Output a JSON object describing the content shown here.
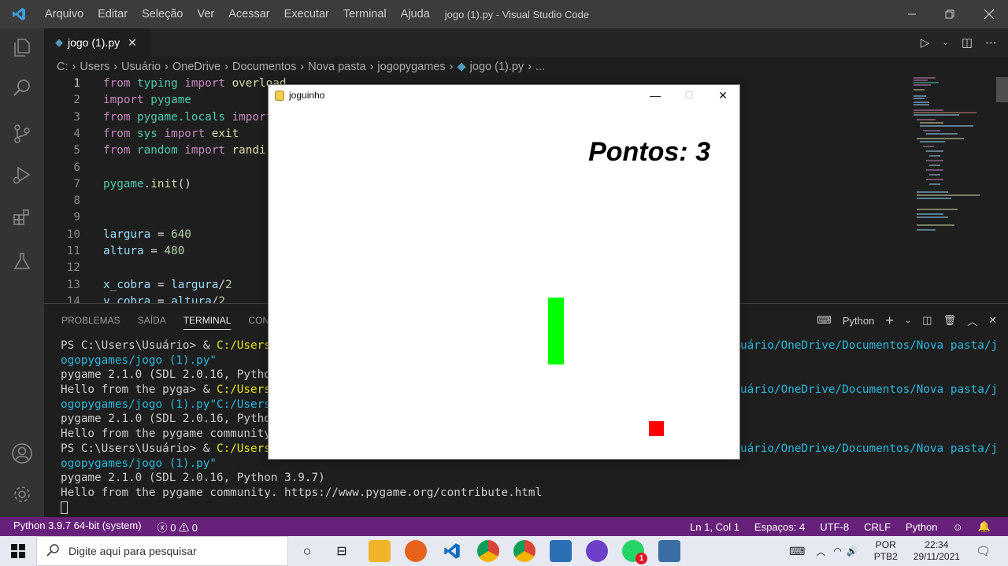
{
  "window": {
    "menu": [
      "Arquivo",
      "Editar",
      "Seleção",
      "Ver",
      "Acessar",
      "Executar",
      "Terminal",
      "Ajuda"
    ],
    "title": "jogo (1).py - Visual Studio Code"
  },
  "editor": {
    "tab_label": "jogo (1).py",
    "breadcrumb": [
      "C:",
      "Users",
      "Usuário",
      "OneDrive",
      "Documentos",
      "Nova pasta",
      "jogopygames",
      "jogo (1).py",
      "..."
    ],
    "lines": [
      {
        "n": "1",
        "text": "from typing import overload"
      },
      {
        "n": "2",
        "text": "import pygame"
      },
      {
        "n": "3",
        "text": "from pygame.locals import"
      },
      {
        "n": "4",
        "text": "from sys import exit"
      },
      {
        "n": "5",
        "text": "from random import randi"
      },
      {
        "n": "6",
        "text": ""
      },
      {
        "n": "7",
        "text": "pygame.init()"
      },
      {
        "n": "8",
        "text": ""
      },
      {
        "n": "9",
        "text": ""
      },
      {
        "n": "10",
        "text": "largura = 640"
      },
      {
        "n": "11",
        "text": "altura = 480"
      },
      {
        "n": "12",
        "text": ""
      },
      {
        "n": "13",
        "text": "x_cobra = largura/2"
      },
      {
        "n": "14",
        "text": "y_cobra = altura/2"
      }
    ]
  },
  "panel": {
    "tabs": [
      "PROBLEMAS",
      "SAÍDA",
      "TERMINAL",
      "CON"
    ],
    "active_tab": "TERMINAL",
    "shell": "Python",
    "terminal_lines": [
      {
        "a": "PS C:\\Users\\Usuário> & ",
        "b": "C:/Users",
        "c": "uário/OneDrive/Documentos/Nova pasta/j"
      },
      {
        "a": "",
        "b": "",
        "c": "ogopygames/jogo (1).py\""
      },
      {
        "a": "pygame 2.1.0 (SDL 2.0.16, Pytho",
        "b": "",
        "c": ""
      },
      {
        "a": "Hello from the pyga> & ",
        "b": "C:/Users",
        "c": "uário/OneDrive/Documentos/Nova pasta/j"
      },
      {
        "a": "",
        "b": "",
        "c": "ogopygames/jogo (1).py\"C:/Users"
      },
      {
        "a": "pygame 2.1.0 (SDL 2.0.16, Pytho",
        "b": "",
        "c": ""
      },
      {
        "a": "Hello from the pygame community",
        "b": "",
        "c": ""
      },
      {
        "a": "PS C:\\Users\\Usuário> & ",
        "b": "C:/Users",
        "c": "uário/OneDrive/Documentos/Nova pasta/j"
      },
      {
        "a": "",
        "b": "",
        "c": "ogopygames/jogo (1).py\""
      },
      {
        "a": "pygame 2.1.0 (SDL 2.0.16, Python 3.9.7)",
        "b": "",
        "c": ""
      },
      {
        "a": "Hello from the pygame community. https://www.pygame.org/contribute.html",
        "b": "",
        "c": ""
      }
    ]
  },
  "statusbar": {
    "interpreter": "Python 3.9.7 64-bit (system)",
    "errors": "0",
    "warnings": "0",
    "position": "Ln 1, Col 1",
    "spaces": "Espaços: 4",
    "encoding": "UTF-8",
    "eol": "CRLF",
    "language": "Python"
  },
  "taskbar": {
    "search_placeholder": "Digite aqui para pesquisar",
    "lang_top": "POR",
    "lang_bottom": "PTB2",
    "time": "22:34",
    "date": "29/11/2021",
    "whatsapp_badge": "1"
  },
  "game": {
    "title": "joguinho",
    "score_text": "Pontos: 3"
  },
  "colors": {
    "statusbar": "#68217a",
    "snake": "#00ff00",
    "apple": "#ff0000"
  }
}
